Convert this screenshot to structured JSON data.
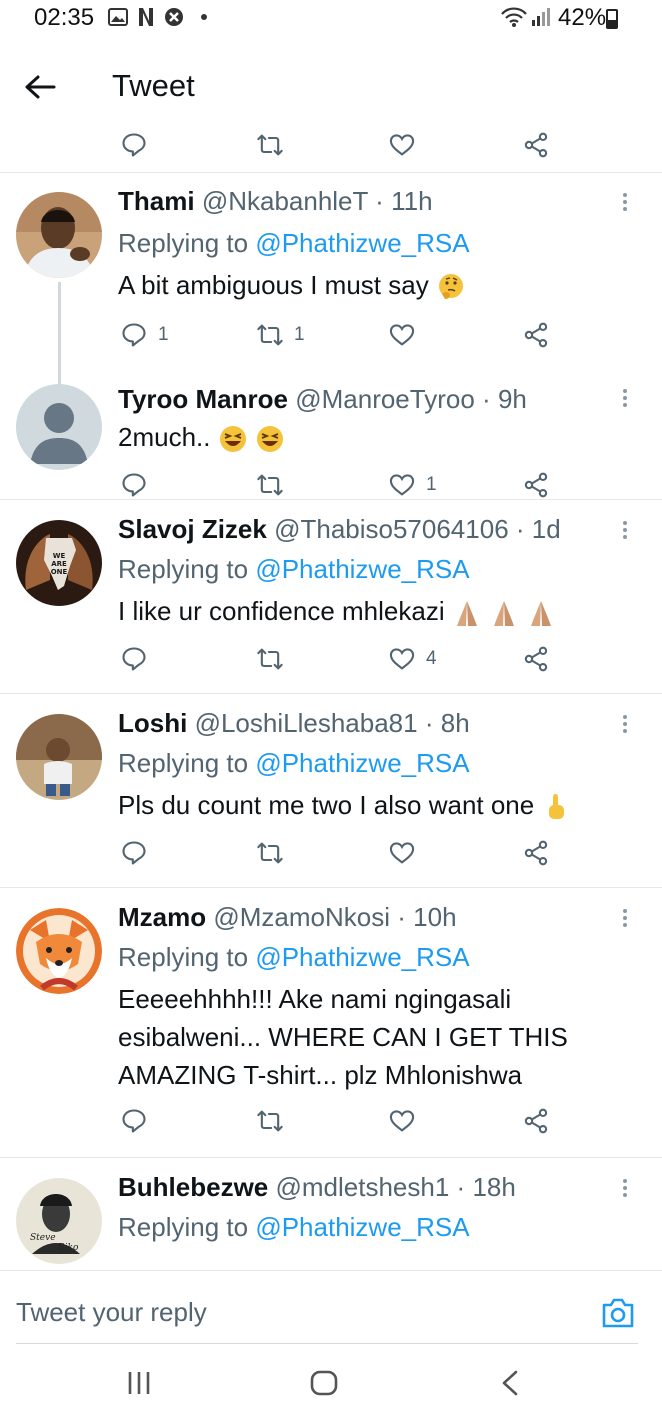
{
  "status_bar": {
    "time": "02:35",
    "battery": "42%",
    "icons": [
      "gallery-icon",
      "netflix-icon",
      "vpn-shield-icon",
      "dot-icon",
      "wifi-icon",
      "signal-icon",
      "battery-icon"
    ]
  },
  "header": {
    "title": "Tweet",
    "back_icon": "arrow-left-icon"
  },
  "tweets": [
    {
      "name": "Thami",
      "handle": "@NkabanhleT",
      "sep": "·",
      "time": "11h",
      "replying_prefix": "Replying to",
      "replying_to": "@Phathizwe_RSA",
      "text": "A bit ambiguous I must say",
      "emoji": "thinking-face-emoji",
      "replies": "1",
      "retweets": "1",
      "likes": ""
    },
    {
      "name": "Tyroo Manroe",
      "handle": "@ManroeTyroo",
      "sep": "·",
      "time": "9h",
      "text": "2much..",
      "emoji": "laughing-face-emoji",
      "replies": "",
      "retweets": "",
      "likes": "1"
    },
    {
      "name": "Slavoj Zizek",
      "handle": "@Thabiso57064106",
      "sep": "·",
      "time": "1d",
      "replying_prefix": "Replying to",
      "replying_to": "@Phathizwe_RSA",
      "text": "I like ur confidence mhlekazi",
      "emoji": "folded-hands-emoji",
      "replies": "",
      "retweets": "",
      "likes": "4",
      "avatar_text": "WE ARE ONE"
    },
    {
      "name": "Loshi",
      "handle": "@LoshiLleshaba81",
      "sep": "·",
      "time": "8h",
      "replying_prefix": "Replying to",
      "replying_to": "@Phathizwe_RSA",
      "text": "Pls du count me two I also want one",
      "emoji": "pointing-up-emoji",
      "replies": "",
      "retweets": "",
      "likes": ""
    },
    {
      "name": "Mzamo",
      "handle": "@MzamoNkosi",
      "sep": "·",
      "time": "10h",
      "replying_prefix": "Replying to",
      "replying_to": "@Phathizwe_RSA",
      "text_lines": [
        "Eeeeehhhh!!! Ake nami ngingasali",
        "esibalweni... WHERE CAN I GET THIS",
        "AMAZING T-shirt... plz Mhlonishwa"
      ],
      "replies": "",
      "retweets": "",
      "likes": ""
    },
    {
      "name": "Buhlebezwe",
      "handle": "@mdletshesh1",
      "sep": "·",
      "time": "18h",
      "replying_prefix": "Replying to",
      "replying_to": "@Phathizwe_RSA",
      "avatar_text": "Steve Biko"
    }
  ],
  "composer": {
    "placeholder": "Tweet your reply",
    "camera_icon": "camera-icon"
  },
  "nav_bar": {
    "icons": [
      "recent-apps-icon",
      "home-icon",
      "back-icon"
    ]
  },
  "colors": {
    "mention": "#1d9bf0",
    "muted": "#536471",
    "text": "#0f1419",
    "divider": "#e4e8eb"
  }
}
